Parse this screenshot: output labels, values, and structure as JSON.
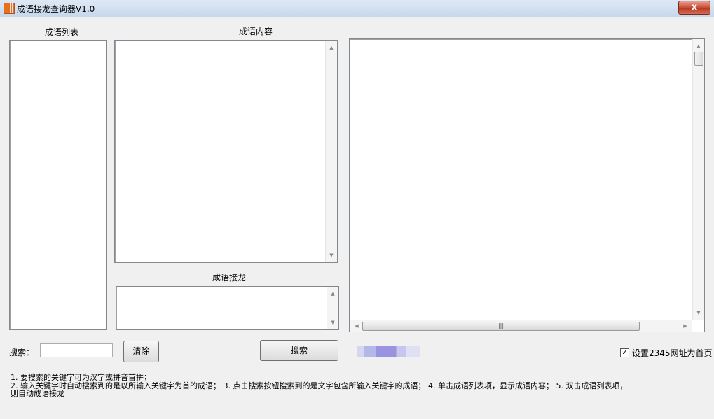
{
  "window": {
    "title": "成语接龙查询器V1.0",
    "close_glyph": "x"
  },
  "labels": {
    "idiom_list": "成语列表",
    "idiom_content": "成语内容",
    "idiom_chain": "成语接龙",
    "search_label": "搜索："
  },
  "buttons": {
    "clear": "清除",
    "search": "搜索"
  },
  "search": {
    "value": "",
    "placeholder": ""
  },
  "checkbox": {
    "label": "设置2345网址为首页",
    "checked": true
  },
  "help": {
    "line1": "1. 要搜索的关键字可为汉字或拼音首拼；",
    "line2": "2. 输入关键字时自动搜索到的是以所输入关键字为首的成语； 3. 点击搜索按钮搜索到的是文字包含所输入关键字的成语； 4. 单击成语列表项，显示成语内容； 5. 双击成语列表项，",
    "line3": "则自动成语接龙"
  },
  "icons": {
    "app": "app-icon",
    "close": "close-icon",
    "up": "scroll-up-arrow-icon",
    "down": "scroll-down-arrow-icon",
    "left": "scroll-left-arrow-icon",
    "right": "scroll-right-arrow-icon"
  }
}
